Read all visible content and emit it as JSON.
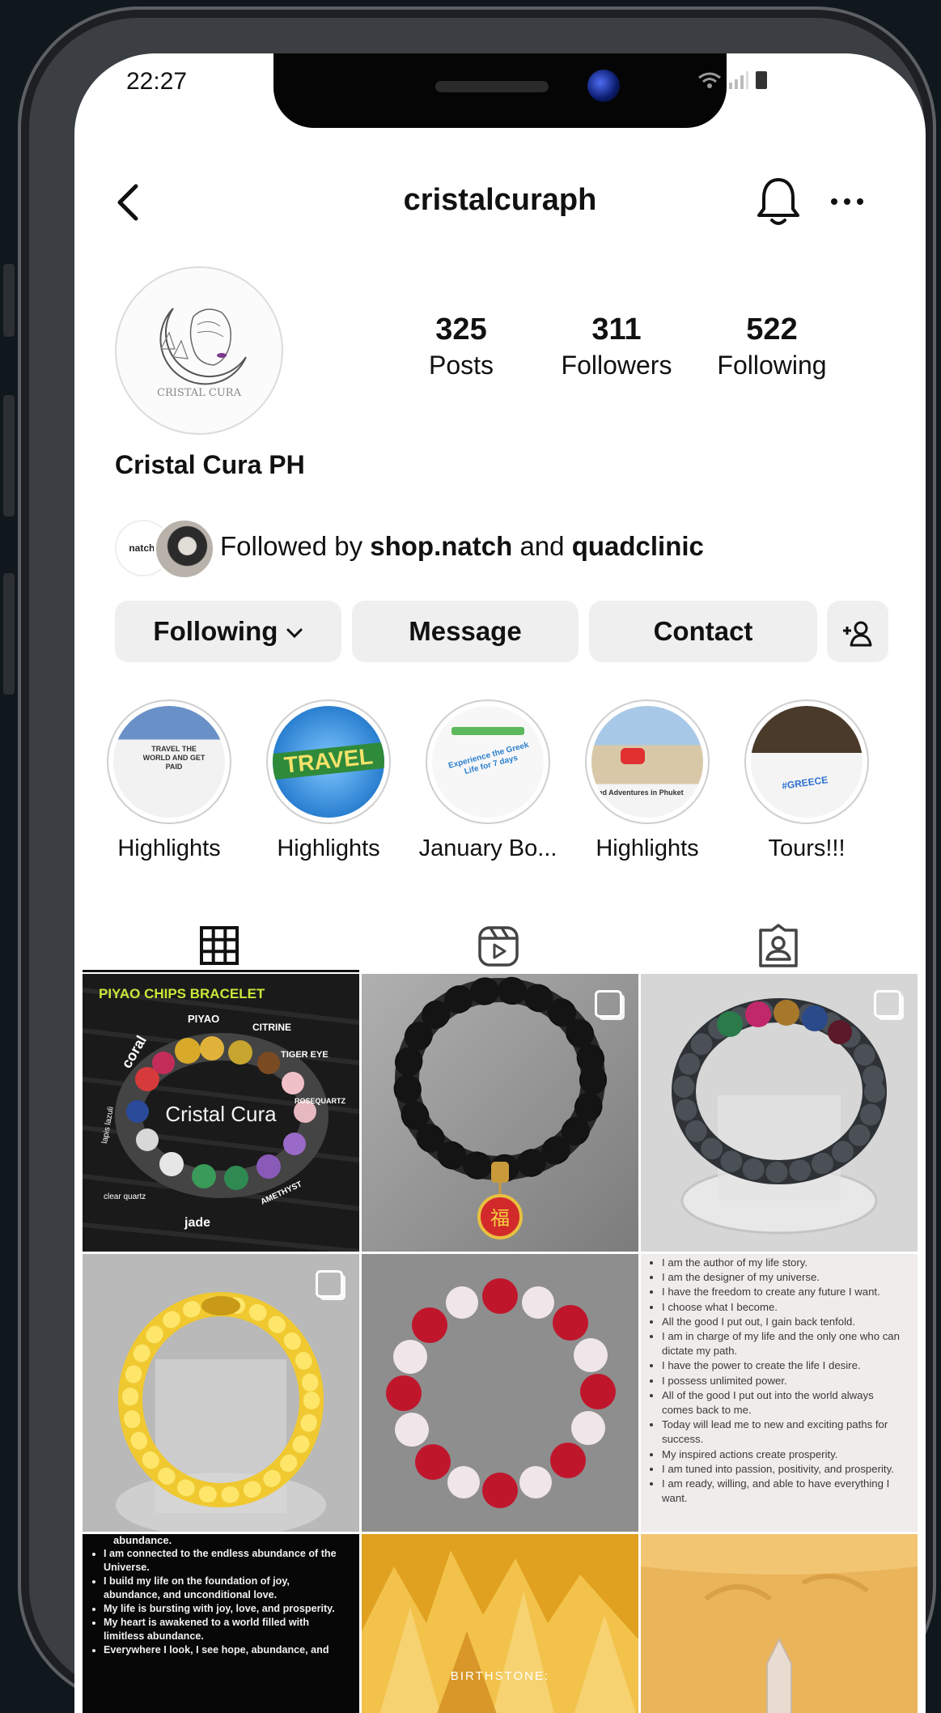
{
  "status_bar": {
    "time": "22:27"
  },
  "profile": {
    "username": "cristalcuraph",
    "display_name": "Cristal Cura PH",
    "avatar_text": "CRISTAL CURA",
    "stats": [
      {
        "value": "325",
        "label": "Posts"
      },
      {
        "value": "311",
        "label": "Followers"
      },
      {
        "value": "522",
        "label": "Following"
      }
    ],
    "followed_by": {
      "prefix": "Followed by",
      "user1": "shop.natch",
      "joiner": "and",
      "user2": "quadclinic",
      "mini_avatar_text": "natch."
    }
  },
  "actions": {
    "following": "Following",
    "message": "Message",
    "contact": "Contact"
  },
  "highlights": [
    {
      "label": "Highlights",
      "text": "TRAVEL THE WORLD AND GET PAID"
    },
    {
      "label": "Highlights",
      "text": "TRAVEL"
    },
    {
      "label": "January Bo...",
      "text": "Experience the Greek Life for 7 days"
    },
    {
      "label": "Highlights",
      "text": "nd Adventures in Phuket"
    },
    {
      "label": "Tours!!!",
      "text": "#GREECE"
    }
  ],
  "posts": {
    "piyao": {
      "title": "PIYAO CHIPS BRACELET",
      "brand": "Cristal Cura",
      "labels": [
        "PIYAO",
        "CITRINE",
        "coral",
        "TIGER EYE",
        "ROSEQUARTZ",
        "lapis lazuli",
        "clear quartz",
        "AMETHYST",
        "jade"
      ]
    },
    "affirmations1": [
      "I am the author of my life story.",
      "I am the designer of my universe.",
      "I have the freedom to create any future I want.",
      "I choose what I become.",
      "All the good I put out, I gain back tenfold.",
      "I am in charge of my life and the only one who can dictate my path.",
      "I have the power to create the life I desire.",
      "I possess unlimited power.",
      "All of the good I put out into the world always comes back to me.",
      "Today will lead me to new and exciting paths for success.",
      "My inspired actions create prosperity.",
      "I am tuned into passion, positivity, and prosperity.",
      "I am ready, willing, and able to have everything I want."
    ],
    "affirmations2_top": "abundance.",
    "affirmations2": [
      "I am connected to the endless abundance of the Universe.",
      "I build my life on the foundation of joy, abundance, and unconditional love.",
      "My life is bursting with joy, love, and prosperity.",
      "My heart is awakened to a world filled with limitless abundance.",
      "Everywhere I look, I see hope, abundance, and"
    ],
    "birthstone": "BIRTHSTONE:"
  },
  "colors": {
    "background": "#10171d",
    "button_bg": "#efefef",
    "text": "#111111"
  }
}
